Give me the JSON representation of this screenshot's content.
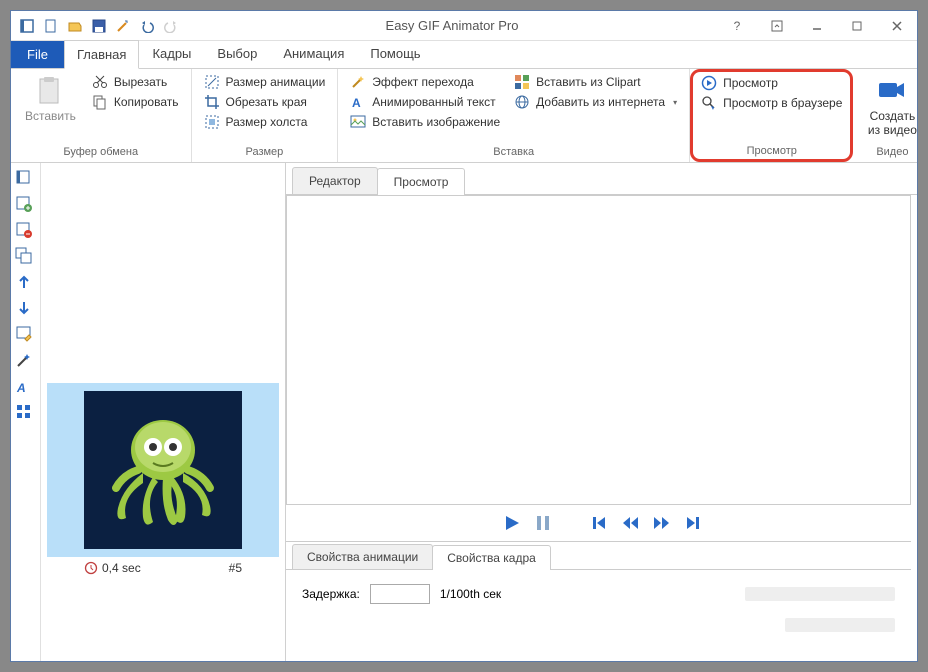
{
  "title": "Easy GIF Animator Pro",
  "file_tab": "File",
  "tabs": [
    "Главная",
    "Кадры",
    "Выбор",
    "Анимация",
    "Помощь"
  ],
  "active_tab": 0,
  "ribbon": {
    "clipboard": {
      "paste": "Вставить",
      "cut": "Вырезать",
      "copy": "Копировать",
      "label": "Буфер обмена"
    },
    "size": {
      "anim_size": "Размер анимации",
      "crop": "Обрезать края",
      "canvas": "Размер холста",
      "label": "Размер"
    },
    "insert": {
      "transition": "Эффект перехода",
      "anim_text": "Анимированный текст",
      "image": "Вставить изображение",
      "clipart": "Вставить из Clipart",
      "internet": "Добавить из интернета",
      "label": "Вставка"
    },
    "preview": {
      "view": "Просмотр",
      "browser": "Просмотр в браузере",
      "label": "Просмотр"
    },
    "video": {
      "create": "Создать из видео",
      "label": "Видео"
    }
  },
  "editor_tabs": [
    "Редактор",
    "Просмотр"
  ],
  "editor_active": 1,
  "frame": {
    "duration": "0,4 sec",
    "number": "#5"
  },
  "props": {
    "tabs": [
      "Свойства анимации",
      "Свойства кадра"
    ],
    "active": 1,
    "delay_label": "Задержка:",
    "delay_value": "",
    "delay_unit": "1/100th сек"
  }
}
